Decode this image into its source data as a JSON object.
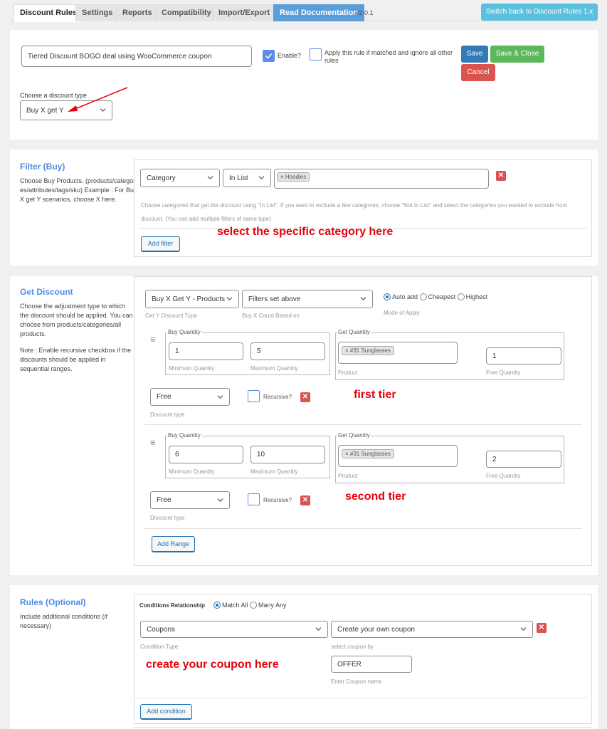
{
  "tabs": [
    {
      "label": "Discount Rules",
      "active": true
    },
    {
      "label": "Settings"
    },
    {
      "label": "Reports"
    },
    {
      "label": "Compatibility"
    },
    {
      "label": "Import/Export"
    },
    {
      "label": "Read Documentation"
    }
  ],
  "version": "v2.0.1",
  "switch_button": "Switch back to Discount Rules 1.x",
  "rule": {
    "title_value": "Tiered Discount BOGO deal using WooCommerce coupon",
    "enable_label": "Enable?",
    "enable_checked": true,
    "exclusive_label": "Apply this rule if matched and ignore all other rules",
    "exclusive_checked": false,
    "save": "Save",
    "save_close": "Save & Close",
    "cancel": "Cancel",
    "discount_type_label": "Choose a discount type",
    "discount_type_value": "Buy X get Y"
  },
  "filter": {
    "title": "Filter (Buy)",
    "desc": "Choose Buy Products. (products/categories/attributes/tags/sku) Example : For Buy X get Y scenarios, choose X here.",
    "type_value": "Category",
    "operator_value": "In List",
    "tag": "× Hoodies",
    "help": "Choose categories that get the discount using \"In List\". If you want to exclude a few categories, choose \"Not In List\" and select the categories you wanted to exclude from discount. (You can add multiple filters of same type)",
    "annotation": "select the specific category here",
    "add_filter": "Add filter"
  },
  "get_discount": {
    "title": "Get Discount",
    "desc1": "Choose the adjustment type to which the discount should be applied. You can choose from products/categories/all products.",
    "desc2": "Note : Enable recursive checkbox if the discounts should be applied in sequential ranges.",
    "y_type_value": "Buy X Get Y - Products",
    "y_type_hint": "Get Y Discount Type",
    "count_based_value": "Filters set above",
    "count_based_hint": "Buy X Count Based on",
    "mode_options": [
      "Auto add",
      "Cheapest",
      "Highest"
    ],
    "mode_selected": "Auto add",
    "mode_hint": "Mode of Apply",
    "buy_qty_legend": "Buy Quantity",
    "get_qty_legend": "Get Quantity",
    "min_hint": "Minimum Quantity",
    "max_hint": "Maximum Quantity",
    "product_hint": "Product",
    "free_qty_hint": "Free Quantity",
    "discount_type_hint": "Discount type",
    "recursive_label": "Recursive?",
    "ranges": [
      {
        "min": "1",
        "max": "5",
        "product_tag": "× #31 Sunglasses",
        "free_qty": "1",
        "discount_type": "Free",
        "recursive": false,
        "annotation": "first tier"
      },
      {
        "min": "6",
        "max": "10",
        "product_tag": "× #31 Sunglasses",
        "free_qty": "2",
        "discount_type": "Free",
        "recursive": false,
        "annotation": "second tier"
      }
    ],
    "add_range": "Add Range"
  },
  "rules": {
    "title": "Rules (Optional)",
    "desc": "Include additional conditions (if necessary)",
    "relationship_label": "Conditions Relationship",
    "relationship_options": [
      "Match All",
      "Many Any"
    ],
    "relationship_selected": "Match All",
    "condition_type_value": "Coupons",
    "condition_type_hint": "Condition Type",
    "coupon_by_value": "Create your own coupon",
    "coupon_by_hint": "select coupon by",
    "coupon_name_value": "OFFER",
    "coupon_name_hint": "Enter Coupon name",
    "annotation": "create your coupon here",
    "add_condition": "Add condition"
  },
  "colors": {
    "accent_blue": "#4f8ae8",
    "save": "#337ab7",
    "save_close": "#5cb85c",
    "cancel": "#d9534f",
    "switch": "#5bc0de",
    "annotation": "#e8000b"
  }
}
